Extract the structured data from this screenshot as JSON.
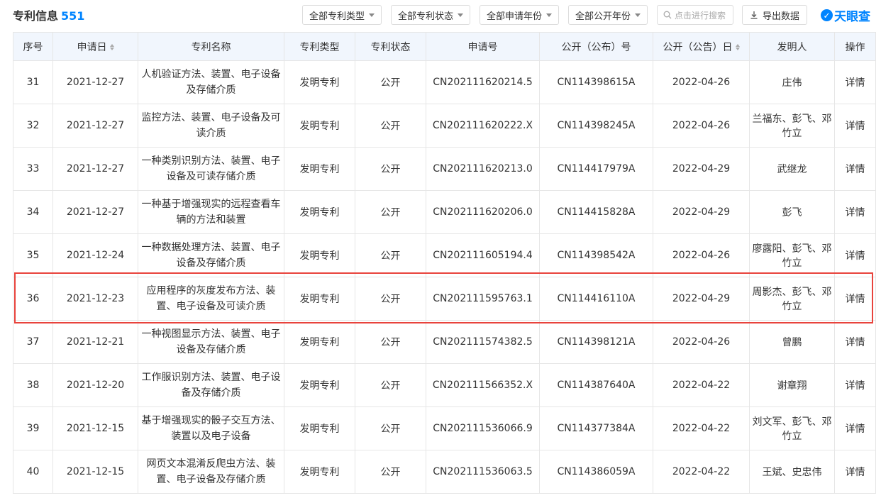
{
  "header": {
    "title": "专利信息",
    "count": "551",
    "filters": [
      "全部专利类型",
      "全部专利状态",
      "全部申请年份",
      "全部公开年份"
    ],
    "search_placeholder": "点击进行搜索",
    "export_label": "导出数据",
    "brand": "天眼查"
  },
  "table": {
    "columns": [
      "序号",
      "申请日",
      "专利名称",
      "专利类型",
      "专利状态",
      "申请号",
      "公开（公布）号",
      "公开（公告）日",
      "发明人",
      "操作"
    ],
    "rows": [
      {
        "no": "31",
        "date": "2021-12-27",
        "name": "人机验证方法、装置、电子设备及存储介质",
        "type": "发明专利",
        "status": "公开",
        "app_no": "CN202111620214.5",
        "pub_no": "CN114398615A",
        "pub_date": "2022-04-26",
        "inventors": "庄伟",
        "action": "详情"
      },
      {
        "no": "32",
        "date": "2021-12-27",
        "name": "监控方法、装置、电子设备及可读介质",
        "type": "发明专利",
        "status": "公开",
        "app_no": "CN202111620222.X",
        "pub_no": "CN114398245A",
        "pub_date": "2022-04-26",
        "inventors": "兰福东、彭飞、邓竹立",
        "action": "详情"
      },
      {
        "no": "33",
        "date": "2021-12-27",
        "name": "一种类别识别方法、装置、电子设备及可读存储介质",
        "type": "发明专利",
        "status": "公开",
        "app_no": "CN202111620213.0",
        "pub_no": "CN114417979A",
        "pub_date": "2022-04-29",
        "inventors": "武继龙",
        "action": "详情"
      },
      {
        "no": "34",
        "date": "2021-12-27",
        "name": "一种基于增强现实的远程查看车辆的方法和装置",
        "type": "发明专利",
        "status": "公开",
        "app_no": "CN202111620206.0",
        "pub_no": "CN114415828A",
        "pub_date": "2022-04-29",
        "inventors": "彭飞",
        "action": "详情"
      },
      {
        "no": "35",
        "date": "2021-12-24",
        "name": "一种数据处理方法、装置、电子设备及存储介质",
        "type": "发明专利",
        "status": "公开",
        "app_no": "CN202111605194.4",
        "pub_no": "CN114398542A",
        "pub_date": "2022-04-26",
        "inventors": "廖露阳、彭飞、邓竹立",
        "action": "详情"
      },
      {
        "no": "36",
        "date": "2021-12-23",
        "name": "应用程序的灰度发布方法、装置、电子设备及可读介质",
        "type": "发明专利",
        "status": "公开",
        "app_no": "CN202111595763.1",
        "pub_no": "CN114416110A",
        "pub_date": "2022-04-29",
        "inventors": "周影杰、彭飞、邓竹立",
        "action": "详情"
      },
      {
        "no": "37",
        "date": "2021-12-21",
        "name": "一种视图显示方法、装置、电子设备及存储介质",
        "type": "发明专利",
        "status": "公开",
        "app_no": "CN202111574382.5",
        "pub_no": "CN114398121A",
        "pub_date": "2022-04-26",
        "inventors": "曾鹏",
        "action": "详情"
      },
      {
        "no": "38",
        "date": "2021-12-20",
        "name": "工作服识别方法、装置、电子设备及存储介质",
        "type": "发明专利",
        "status": "公开",
        "app_no": "CN202111566352.X",
        "pub_no": "CN114387640A",
        "pub_date": "2022-04-22",
        "inventors": "谢章翔",
        "action": "详情"
      },
      {
        "no": "39",
        "date": "2021-12-15",
        "name": "基于增强现实的骰子交互方法、装置以及电子设备",
        "type": "发明专利",
        "status": "公开",
        "app_no": "CN202111536066.9",
        "pub_no": "CN114377384A",
        "pub_date": "2022-04-22",
        "inventors": "刘文军、彭飞、邓竹立",
        "action": "详情"
      },
      {
        "no": "40",
        "date": "2021-12-15",
        "name": "网页文本混淆反爬虫方法、装置、电子设备及存储介质",
        "type": "发明专利",
        "status": "公开",
        "app_no": "CN202111536063.5",
        "pub_no": "CN114386059A",
        "pub_date": "2022-04-22",
        "inventors": "王斌、史忠伟",
        "action": "详情"
      }
    ]
  },
  "colors": {
    "accent": "#0084ff",
    "status": "#9a5fc4",
    "header_bg": "#f1f6fd",
    "highlight": "#e8433c"
  }
}
